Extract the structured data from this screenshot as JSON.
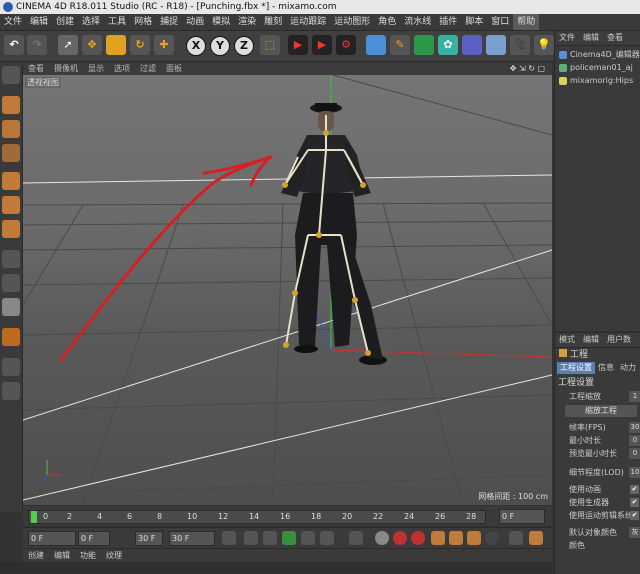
{
  "window": {
    "title": "CINEMA 4D R18.011 Studio (RC - R18) - [Punching.fbx *] - mixamo.com"
  },
  "menu": [
    "文件",
    "编辑",
    "创建",
    "选择",
    "工具",
    "网格",
    "捕捉",
    "动画",
    "模拟",
    "渲染",
    "雕刻",
    "运动跟踪",
    "运动图形",
    "角色",
    "流水线",
    "插件",
    "脚本",
    "窗口",
    "帮助"
  ],
  "menu_active": "帮助",
  "toolbar": {
    "axis_x": "X",
    "axis_y": "Y",
    "axis_z": "Z"
  },
  "viewport": {
    "menu": [
      "查看",
      "摄像机",
      "显示",
      "选项",
      "过滤",
      "面板"
    ],
    "label": "透视视图",
    "grid_label": "网格间距 : 100 cm"
  },
  "timeline": {
    "ticks": [
      "0",
      "2",
      "4",
      "6",
      "8",
      "10",
      "12",
      "14",
      "16",
      "18",
      "20",
      "22",
      "24",
      "26",
      "28"
    ],
    "current_frame": "0 F",
    "end_frame": "0 F"
  },
  "transport": {
    "start": "0 F",
    "range_start": "0 F",
    "range_end": "30 F",
    "end": "30 F"
  },
  "bottom_tabs": [
    "创建",
    "编辑",
    "功能",
    "纹理"
  ],
  "object_manager": {
    "tabs": [
      "文件",
      "编辑",
      "查看"
    ],
    "items": [
      "Cinema4D_编辑器",
      "policeman01_aj",
      "mixamorig:Hips"
    ]
  },
  "attributes": {
    "tabs": [
      "模式",
      "编辑",
      "用户数"
    ],
    "title": "工程",
    "subtabs": [
      "工程设置",
      "信息",
      "动力"
    ],
    "section": "工程设置",
    "scale_label": "工程缩放",
    "scale_value": "1",
    "scale_button": "缩放工程",
    "fps_label": "帧率(FPS)",
    "fps_value": "30",
    "min_label": "最小时长",
    "min_value": "0",
    "preview_min_label": "预览最小时长",
    "preview_min_value": "0",
    "lod_label": "细节程度(LOD)",
    "lod_value": "10",
    "checks": [
      "使用动画",
      "使用生成器",
      "使用运动剪辑系统"
    ],
    "color_label": "默认对象颜色",
    "color_value": "灰",
    "color2_label": "颜色"
  },
  "colors": {
    "accent": "#5b7fb5",
    "arrow": "#d42020",
    "axis_y": "#33cc33",
    "skeleton": "#e6e0c8"
  }
}
